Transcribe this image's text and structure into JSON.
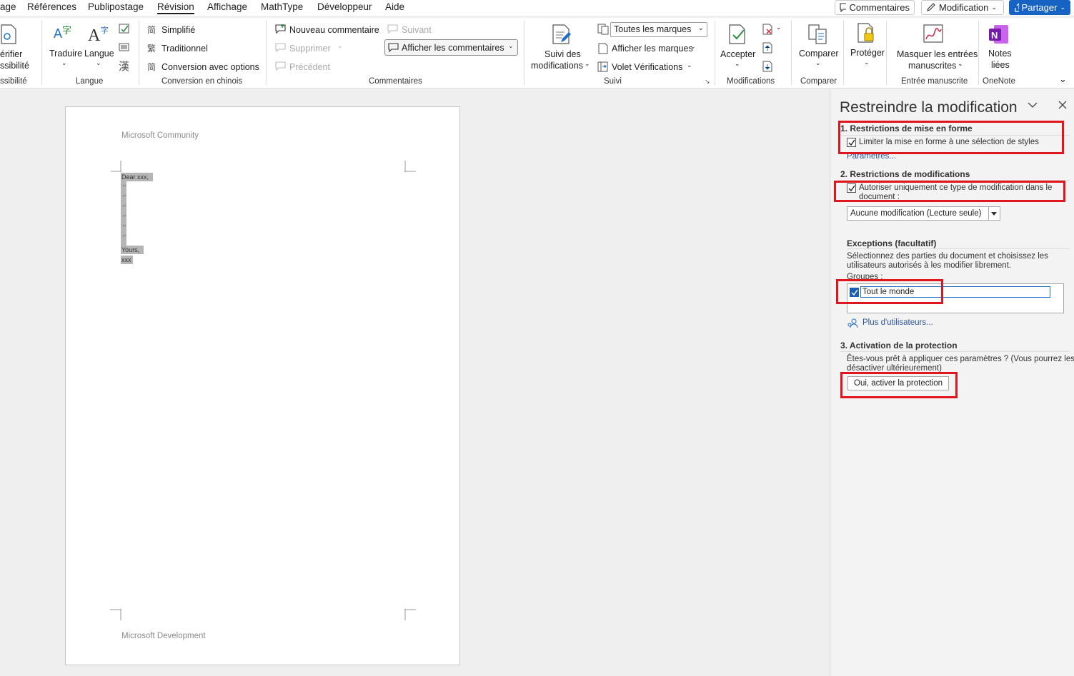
{
  "tabs": [
    "age",
    "Références",
    "Publipostage",
    "Révision",
    "Affichage",
    "MathType",
    "Développeur",
    "Aide"
  ],
  "top_buttons": {
    "comments": "Commentaires",
    "editing": "Modification",
    "share": "Partager"
  },
  "ribbon": {
    "accessibility": {
      "line1": "érifier",
      "line2": "ssibilité",
      "group": "ssibilité"
    },
    "language": {
      "translate": "Traduire",
      "language": "Langue",
      "group": "Langue"
    },
    "chinese": {
      "simplified": "Simplifié",
      "traditional": "Traditionnel",
      "convert": "Conversion avec options",
      "group": "Conversion en chinois"
    },
    "comments": {
      "new": "Nouveau commentaire",
      "delete": "Supprimer",
      "previous": "Précédent",
      "next": "Suivant",
      "show": "Afficher les commentaires",
      "group": "Commentaires"
    },
    "tracking": {
      "track_line1": "Suivi des",
      "track_line2": "modifications",
      "markup": "Toutes les marques",
      "show_markup": "Afficher les marques",
      "reviewing_pane": "Volet Vérifications",
      "group": "Suivi"
    },
    "changes": {
      "accept": "Accepter",
      "group": "Modifications"
    },
    "compare": {
      "compare": "Comparer",
      "group": "Comparer"
    },
    "protect": {
      "protect": "Protéger"
    },
    "ink": {
      "line1": "Masquer les entrées",
      "line2": "manuscrites",
      "group": "Entrée manuscrite"
    },
    "onenote": {
      "line1": "Notes",
      "line2": "liées",
      "group": "OneNote"
    }
  },
  "document": {
    "header": "Microsoft Community",
    "footer": "Microsoft Development",
    "lines": [
      "Dear xxx,",
      "Yours,",
      "xxx"
    ]
  },
  "pane": {
    "title": "Restreindre la modification",
    "section1": {
      "title": "1. Restrictions de mise en forme",
      "checkbox": "Limiter la mise en forme à une sélection de styles",
      "link": "Paramètres..."
    },
    "section2": {
      "title": "2. Restrictions de modifications",
      "checkbox_line1": "Autoriser uniquement ce type de modification dans le",
      "checkbox_line2": "document :",
      "dropdown": "Aucune modification (Lecture seule)",
      "exceptions_title": "Exceptions (facultatif)",
      "exceptions_desc1": "Sélectionnez des parties du document et choisissez les",
      "exceptions_desc2": "utilisateurs autorisés à les modifier librement.",
      "groups_label": "Groupes :",
      "group_everyone": "Tout le monde",
      "more_users": "Plus d'utilisateurs..."
    },
    "section3": {
      "title": "3. Activation de la protection",
      "desc1": "Êtes-vous prêt à appliquer ces paramètres ? (Vous pourrez les",
      "desc2": "désactiver ultérieurement)",
      "button": "Oui, activer la protection"
    }
  },
  "colors": {
    "accent": "#1763c4",
    "highlight": "#e0151d"
  }
}
